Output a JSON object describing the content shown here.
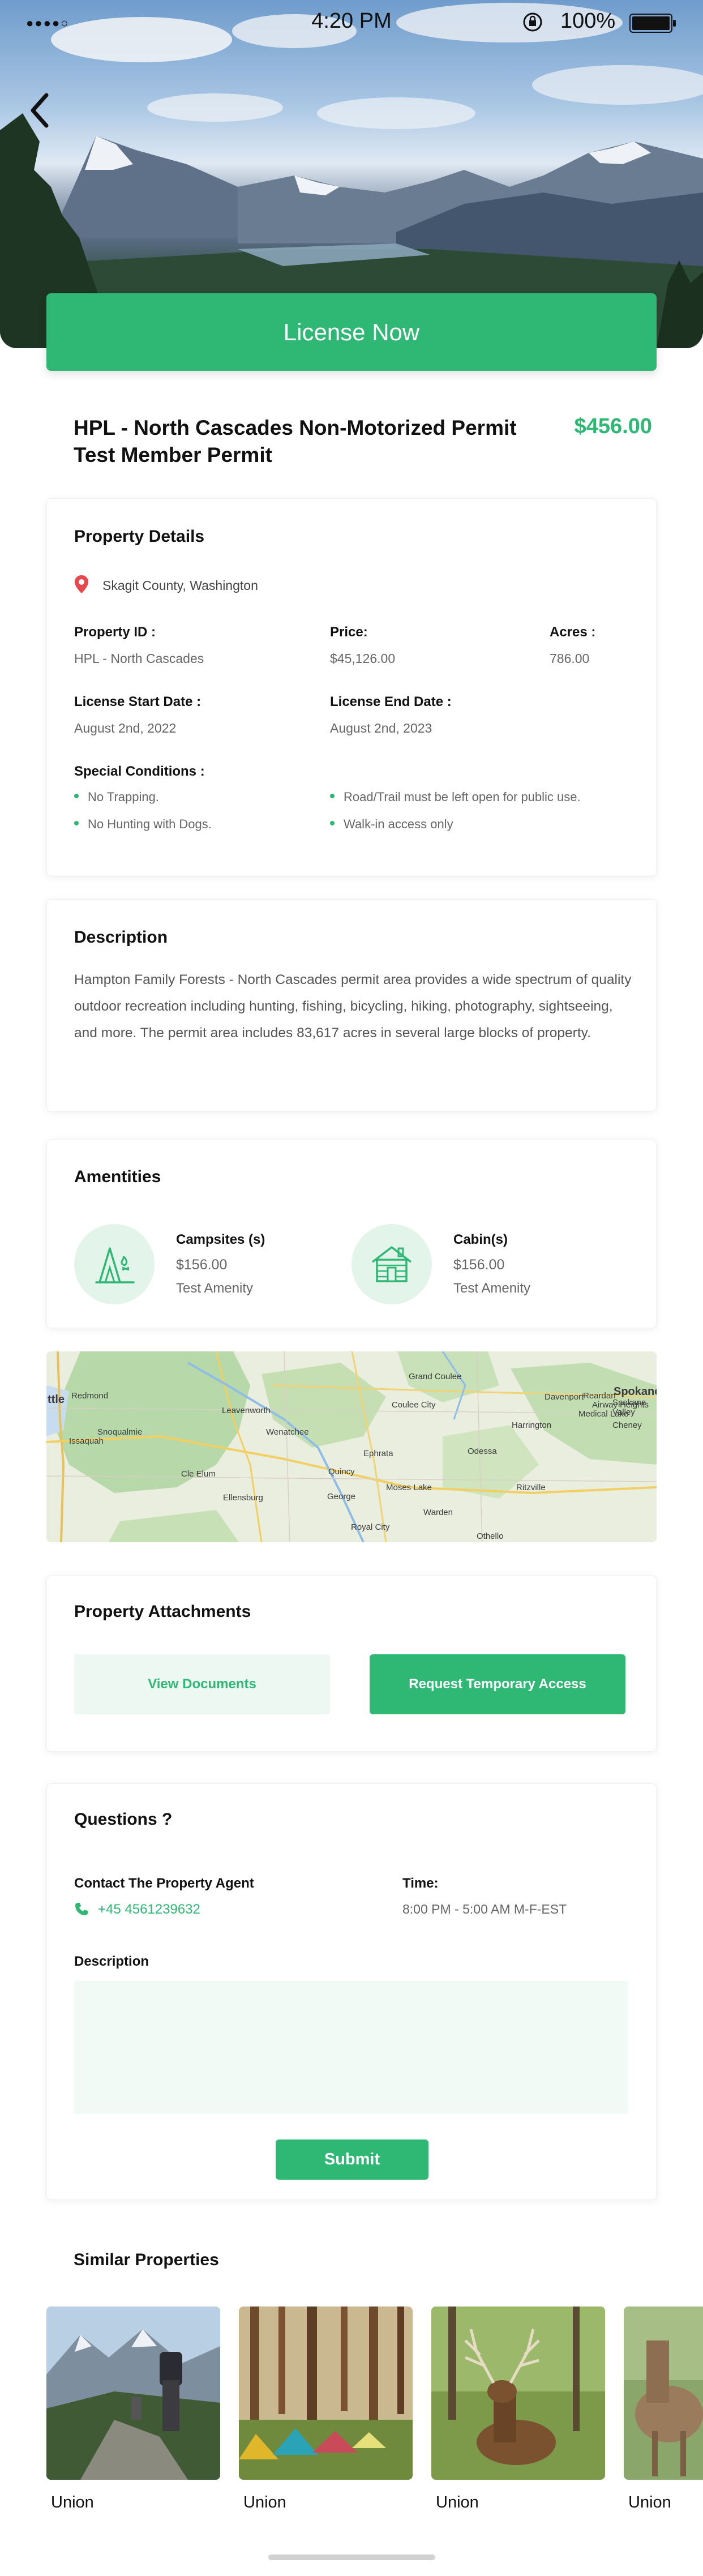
{
  "status_bar": {
    "time": "4:20 PM",
    "battery": "100%"
  },
  "hero": {
    "license_button": "License Now"
  },
  "permit": {
    "title_line1": "HPL - North Cascades Non-Motorized Permit",
    "title_line2": "Test Member Permit",
    "price": "$456.00"
  },
  "property_details": {
    "heading": "Property Details",
    "location": "Skagit County, Washington",
    "property_id_label": "Property ID :",
    "property_id_value": "HPL - North Cascades",
    "price_label": "Price:",
    "price_value": "$45,126.00",
    "acres_label": "Acres :",
    "acres_value": "786.00",
    "license_start_label": "License Start Date :",
    "license_start_value": "August 2nd, 2022",
    "license_end_label": "License End Date :",
    "license_end_value": "August 2nd, 2023",
    "special_conditions_label": "Special Conditions :",
    "conditions": [
      "No Trapping.",
      "Road/Trail must be left open for public use.",
      "No Hunting with Dogs.",
      "Walk-in access only"
    ]
  },
  "description": {
    "heading": "Description",
    "text": "Hampton Family Forests - North Cascades permit area provides a wide spectrum of quality outdoor recreation including hunting, fishing, bicycling, hiking, photography, sightseeing, and more. The permit area includes 83,617 acres in several large blocks of property."
  },
  "amenities": {
    "heading": "Amentities",
    "items": [
      {
        "name": "Campsites (s)",
        "price": "$156.00",
        "sub": "Test Amenity",
        "icon": "campsite-icon"
      },
      {
        "name": "Cabin(s)",
        "price": "$156.00",
        "sub": "Test Amenity",
        "icon": "cabin-icon"
      }
    ]
  },
  "map": {
    "labels": [
      "ttle",
      "Redmond",
      "Snoqualmie",
      "Issaquah",
      "Leavenworth",
      "Wenatchee",
      "Cle Elum",
      "Ellensburg",
      "Quincy",
      "George",
      "Ephrata",
      "Moses Lake",
      "Royal City",
      "Warden",
      "Coulee City",
      "Grand Coulee",
      "Odessa",
      "Ritzville",
      "Harrington",
      "Davenport",
      "Reardan",
      "Airway Heights",
      "Medical Lake",
      "Cheney",
      "Spokane",
      "Spokane Valley",
      "Othello"
    ]
  },
  "attachments": {
    "heading": "Property Attachments",
    "view_documents": "View Documents",
    "request_access": "Request Temporary Access"
  },
  "questions": {
    "heading": "Questions ?",
    "contact_label": "Contact The Property Agent",
    "phone": "+45 4561239632",
    "time_label": "Time:",
    "time_value": "8:00 PM - 5:00 AM M-F-EST",
    "description_label": "Description",
    "submit": "Submit"
  },
  "similar": {
    "heading": "Similar Properties",
    "items": [
      {
        "label": "Union"
      },
      {
        "label": "Union"
      },
      {
        "label": "Union"
      },
      {
        "label": "Union"
      }
    ]
  },
  "colors": {
    "accent": "#2fb774",
    "accent_light": "#e3f4eb"
  }
}
